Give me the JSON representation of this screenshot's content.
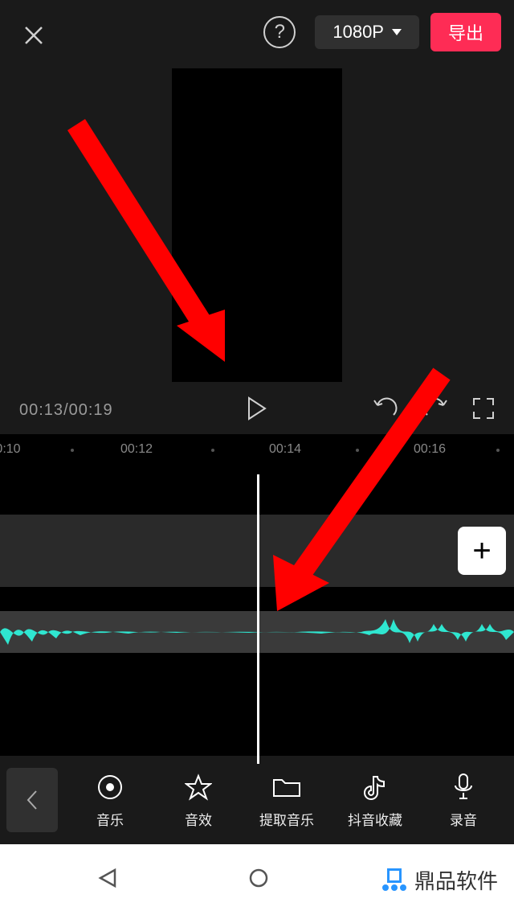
{
  "header": {
    "resolution_label": "1080P",
    "export_label": "导出"
  },
  "playback": {
    "current_time": "00:13",
    "total_time": "00:19"
  },
  "ruler": {
    "ticks": [
      "0:10",
      "00:12",
      "00:14",
      "00:16"
    ]
  },
  "add_clip_label": "+",
  "tools": {
    "music": "音乐",
    "sfx": "音效",
    "extract": "提取音乐",
    "douyin": "抖音收藏",
    "record": "录音"
  },
  "watermark": {
    "text": "鼎品软件"
  },
  "icons": {
    "close": "close-icon",
    "help": "?",
    "play": "play-icon",
    "undo": "undo-icon",
    "redo": "redo-icon",
    "fullscreen": "fullscreen-icon"
  }
}
